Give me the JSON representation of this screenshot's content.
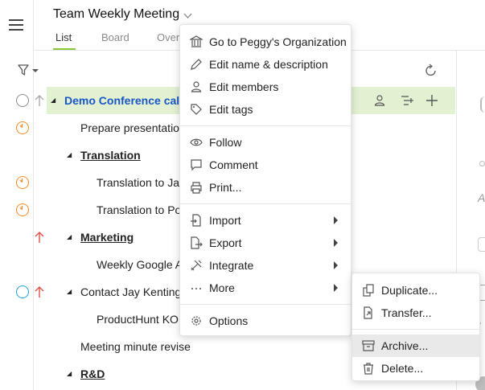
{
  "header": {
    "title": "Team Weekly Meeting",
    "tabs": [
      {
        "label": "List",
        "active": true
      },
      {
        "label": "Board",
        "active": false
      },
      {
        "label": "Over",
        "active": false
      }
    ]
  },
  "rows": [
    {
      "text": "Demo Conference call v",
      "kind": "link",
      "status": "ring",
      "priority": "gray",
      "triangle": true
    },
    {
      "text": "Prepare presentation",
      "kind": "plain",
      "status": "orange",
      "priority": "",
      "triangle": false
    },
    {
      "text": "Translation",
      "kind": "section",
      "status": "",
      "priority": "",
      "triangle": true
    },
    {
      "text": "Translation to Jap",
      "kind": "plain",
      "status": "orange",
      "priority": "",
      "triangle": false
    },
    {
      "text": "Translation to Po",
      "kind": "plain",
      "status": "orange",
      "priority": "",
      "triangle": false
    },
    {
      "text": "Marketing",
      "kind": "section",
      "status": "",
      "priority": "red",
      "triangle": true
    },
    {
      "text": "Weekly Google A",
      "kind": "plain",
      "status": "",
      "priority": "",
      "triangle": false
    },
    {
      "text": "Contact Jay Kenting",
      "kind": "plain",
      "status": "blue",
      "priority": "red",
      "triangle": true
    },
    {
      "text": "ProductHunt KO",
      "kind": "plain",
      "status": "",
      "priority": "",
      "triangle": false
    },
    {
      "text": "Meeting minute revise",
      "kind": "plain",
      "status": "",
      "priority": "",
      "triangle": false
    },
    {
      "text": "R&D",
      "kind": "section",
      "status": "",
      "priority": "",
      "triangle": true
    }
  ],
  "context_menu": {
    "groups": [
      [
        {
          "label": "Go to Peggy's Organization",
          "icon": "organization-icon"
        },
        {
          "label": "Edit name & description",
          "icon": "pencil-icon"
        },
        {
          "label": "Edit members",
          "icon": "person-icon"
        },
        {
          "label": "Edit tags",
          "icon": "tag-icon"
        }
      ],
      [
        {
          "label": "Follow",
          "icon": "eye-icon"
        },
        {
          "label": "Comment",
          "icon": "comment-icon"
        },
        {
          "label": "Print...",
          "icon": "printer-icon"
        }
      ],
      [
        {
          "label": "Import",
          "icon": "import-icon",
          "submenu": true
        },
        {
          "label": "Export",
          "icon": "export-icon",
          "submenu": true
        },
        {
          "label": "Integrate",
          "icon": "tools-icon",
          "submenu": true
        },
        {
          "label": "More",
          "icon": "ellipsis-icon",
          "submenu": true
        }
      ],
      [
        {
          "label": "Options",
          "icon": "gear-icon"
        }
      ]
    ]
  },
  "more_submenu": {
    "groups": [
      [
        {
          "label": "Duplicate...",
          "icon": "duplicate-icon"
        },
        {
          "label": "Transfer...",
          "icon": "transfer-icon"
        }
      ],
      [
        {
          "label": "Archive...",
          "icon": "archive-icon",
          "hover": true
        },
        {
          "label": "Delete...",
          "icon": "trash-icon"
        }
      ]
    ]
  },
  "colors": {
    "accent_green": "#8cc63f",
    "highlight_row": "#e3f1d3",
    "link_blue": "#1a56c8",
    "status_orange": "#f08a24",
    "status_blue": "#1fa2d6",
    "priority_red": "#e0524a"
  }
}
